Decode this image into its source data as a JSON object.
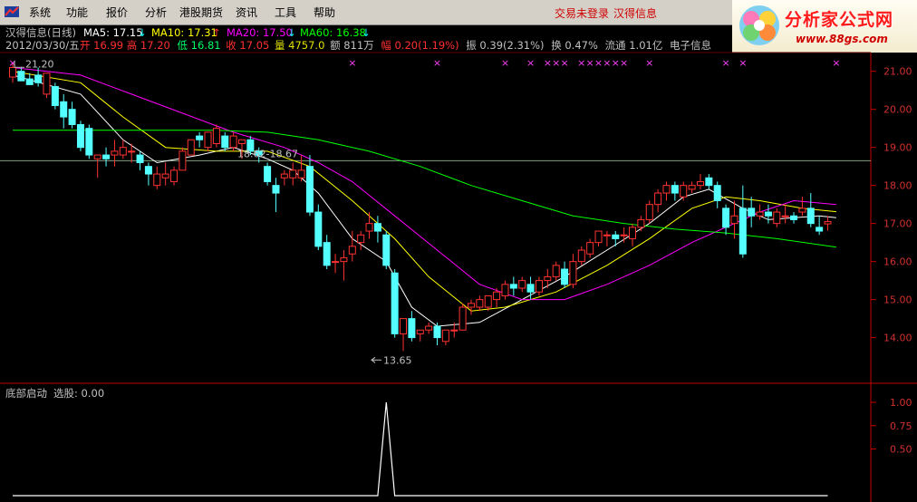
{
  "menubar": {
    "items": [
      "系统",
      "功能",
      "报价",
      "分析",
      "港股期货",
      "资讯",
      "工具",
      "帮助"
    ],
    "login_status": "交易未登录",
    "stock_link": "汉得信息"
  },
  "brand": {
    "title": "分析家公式网",
    "url": "www.88gs.com"
  },
  "header": {
    "title": "汉得信息(日线)",
    "ma": [
      {
        "label": "MA5: 17.15",
        "arrow": "↓",
        "color": "#ffffff"
      },
      {
        "label": "MA10: 17.31",
        "arrow": "↑",
        "color": "#ffff00"
      },
      {
        "label": "MA20: 17.50",
        "arrow": "↓",
        "color": "#ff00ff"
      },
      {
        "label": "MA60: 16.38",
        "arrow": "↓",
        "color": "#00ff00"
      }
    ],
    "info": {
      "date": "2012/03/30/五",
      "open_label": "开",
      "open": "16.99",
      "high_label": "高",
      "high": "17.20",
      "low_label": "低",
      "low": "16.81",
      "close_label": "收",
      "close": "17.05",
      "volume_label": "量",
      "volume": "4757.0",
      "amount_label": "额",
      "amount": "811万",
      "change_label": "幅",
      "change": "0.20(1.19%)",
      "amp_label": "振",
      "amp": "0.39(2.31%)",
      "turnover_label": "换",
      "turnover": "0.47%",
      "float_label": "流通",
      "float": "1.01亿",
      "sector": "电子信息"
    }
  },
  "price_panel": {
    "ymin": 13.3,
    "ymax": 21.35,
    "y_ticks": [
      21.0,
      20.0,
      19.0,
      18.0,
      17.0,
      16.0,
      15.0,
      14.0
    ],
    "marks": {
      "high": "21.20",
      "low": "13.65",
      "range": "18.62-18.67"
    },
    "hline_price": 18.65,
    "signal_marker": "×"
  },
  "indicator_panel": {
    "name": "底部启动",
    "label": "选股: 0.00",
    "y_ticks": [
      "1.00",
      "0.75",
      "0.50"
    ],
    "spike_value": 1.0
  },
  "chart_data": {
    "type": "candlestick",
    "title": "汉得信息(日线)",
    "candles": [
      [
        20.85,
        21.2,
        21.1,
        20.7
      ],
      [
        21.0,
        21.1,
        20.75,
        20.8
      ],
      [
        20.8,
        20.95,
        20.65,
        20.7
      ],
      [
        20.9,
        21.1,
        20.7,
        20.6
      ],
      [
        20.4,
        20.9,
        20.95,
        20.3
      ],
      [
        20.6,
        20.7,
        20.1,
        20.0
      ],
      [
        20.2,
        20.4,
        19.8,
        19.5
      ],
      [
        20.0,
        20.2,
        19.6,
        19.5
      ],
      [
        19.6,
        19.7,
        19.0,
        18.9
      ],
      [
        19.5,
        19.6,
        18.8,
        18.7
      ],
      [
        18.7,
        18.8,
        18.8,
        18.2
      ],
      [
        18.8,
        19.0,
        18.7,
        18.5
      ],
      [
        18.8,
        19.2,
        18.9,
        18.5
      ],
      [
        18.8,
        19.2,
        19.0,
        18.7
      ],
      [
        18.9,
        19.1,
        18.9,
        18.6
      ],
      [
        18.8,
        18.9,
        18.6,
        18.4
      ],
      [
        18.5,
        18.6,
        18.3,
        18.0
      ],
      [
        18.0,
        18.5,
        18.3,
        17.9
      ],
      [
        18.2,
        18.6,
        18.3,
        18.0
      ],
      [
        18.1,
        18.5,
        18.4,
        18.0
      ],
      [
        18.4,
        19.0,
        18.9,
        18.4
      ],
      [
        18.8,
        19.2,
        19.2,
        18.8
      ],
      [
        19.3,
        19.4,
        19.2,
        19.0
      ],
      [
        19.0,
        19.1,
        19.4,
        18.9
      ],
      [
        19.1,
        19.6,
        19.5,
        19.0
      ],
      [
        19.3,
        19.4,
        19.0,
        18.9
      ],
      [
        19.0,
        19.4,
        19.3,
        18.9
      ],
      [
        19.1,
        19.2,
        19.2,
        18.7
      ],
      [
        19.2,
        19.3,
        18.9,
        18.8
      ],
      [
        18.9,
        19.0,
        18.8,
        18.6
      ],
      [
        18.5,
        18.6,
        18.1,
        18.0
      ],
      [
        18.0,
        18.2,
        17.8,
        17.3
      ],
      [
        18.2,
        18.4,
        18.3,
        18.0
      ],
      [
        18.2,
        18.6,
        18.4,
        18.0
      ],
      [
        18.2,
        18.8,
        18.4,
        18.1
      ],
      [
        18.5,
        18.8,
        17.3,
        17.2
      ],
      [
        17.3,
        17.5,
        16.4,
        16.3
      ],
      [
        16.5,
        16.7,
        15.9,
        15.8
      ],
      [
        16.0,
        16.2,
        16.0,
        15.7
      ],
      [
        16.0,
        16.3,
        16.1,
        15.5
      ],
      [
        16.2,
        16.8,
        16.4,
        16.0
      ],
      [
        16.5,
        16.8,
        16.7,
        16.3
      ],
      [
        16.8,
        17.3,
        17.0,
        16.6
      ],
      [
        17.0,
        17.2,
        16.8,
        16.5
      ],
      [
        16.7,
        16.8,
        15.9,
        15.8
      ],
      [
        15.7,
        15.8,
        14.1,
        14.0
      ],
      [
        14.1,
        14.3,
        14.5,
        13.65
      ],
      [
        14.5,
        14.7,
        14.0,
        13.9
      ],
      [
        14.1,
        14.2,
        14.2,
        13.9
      ],
      [
        14.2,
        14.4,
        14.3,
        14.1
      ],
      [
        14.3,
        14.4,
        14.0,
        13.8
      ],
      [
        13.9,
        14.2,
        14.2,
        13.8
      ],
      [
        14.2,
        14.4,
        14.2,
        14.0
      ],
      [
        14.2,
        14.9,
        14.8,
        14.2
      ],
      [
        14.8,
        15.0,
        14.9,
        14.6
      ],
      [
        14.8,
        15.1,
        15.0,
        14.7
      ],
      [
        14.8,
        15.1,
        15.1,
        14.7
      ],
      [
        15.0,
        15.3,
        15.2,
        14.8
      ],
      [
        15.1,
        15.5,
        15.4,
        15.0
      ],
      [
        15.4,
        15.6,
        15.3,
        15.1
      ],
      [
        15.3,
        15.6,
        15.5,
        15.2
      ],
      [
        15.4,
        15.6,
        15.2,
        15.0
      ],
      [
        15.2,
        15.6,
        15.5,
        15.1
      ],
      [
        15.5,
        15.8,
        15.6,
        15.3
      ],
      [
        15.6,
        16.0,
        15.9,
        15.5
      ],
      [
        15.8,
        16.0,
        15.4,
        15.3
      ],
      [
        15.4,
        16.2,
        16.0,
        15.3
      ],
      [
        16.0,
        16.4,
        16.3,
        15.9
      ],
      [
        16.2,
        16.6,
        16.5,
        16.1
      ],
      [
        16.5,
        16.8,
        16.8,
        16.4
      ],
      [
        16.7,
        16.8,
        16.7,
        16.4
      ],
      [
        16.7,
        16.8,
        16.6,
        16.4
      ],
      [
        16.7,
        16.9,
        16.7,
        16.5
      ],
      [
        16.6,
        17.0,
        16.9,
        16.4
      ],
      [
        16.9,
        17.2,
        17.1,
        16.8
      ],
      [
        17.1,
        17.6,
        17.5,
        17.0
      ],
      [
        17.5,
        17.9,
        17.8,
        17.3
      ],
      [
        17.8,
        18.1,
        18.0,
        17.6
      ],
      [
        18.0,
        18.1,
        17.8,
        17.6
      ],
      [
        17.7,
        18.1,
        18.0,
        17.6
      ],
      [
        17.9,
        18.1,
        18.0,
        17.8
      ],
      [
        18.0,
        18.3,
        18.1,
        17.9
      ],
      [
        18.2,
        18.3,
        18.0,
        17.9
      ],
      [
        18.0,
        18.1,
        17.6,
        17.4
      ],
      [
        17.4,
        17.5,
        16.9,
        16.7
      ],
      [
        17.0,
        17.6,
        17.2,
        16.6
      ],
      [
        17.4,
        18.0,
        16.2,
        16.1
      ],
      [
        17.4,
        17.7,
        17.2,
        16.9
      ],
      [
        17.2,
        17.5,
        17.3,
        17.1
      ],
      [
        17.3,
        17.5,
        17.2,
        17.0
      ],
      [
        17.0,
        17.4,
        17.3,
        16.9
      ],
      [
        17.2,
        17.5,
        17.2,
        17.0
      ],
      [
        17.2,
        17.3,
        17.1,
        17.0
      ],
      [
        17.3,
        17.7,
        17.4,
        17.2
      ],
      [
        17.4,
        17.8,
        17.0,
        16.9
      ],
      [
        16.9,
        17.2,
        16.8,
        16.7
      ],
      [
        16.99,
        17.2,
        17.05,
        16.81
      ]
    ],
    "ma_series": [
      {
        "name": "MA5",
        "color": "#ffffff",
        "points": [
          [
            0,
            20.9
          ],
          [
            8,
            20.4
          ],
          [
            13,
            19.2
          ],
          [
            17,
            18.6
          ],
          [
            22,
            18.8
          ],
          [
            26,
            19.0
          ],
          [
            30,
            18.7
          ],
          [
            33,
            18.4
          ],
          [
            36,
            17.8
          ],
          [
            40,
            16.6
          ],
          [
            44,
            16.0
          ],
          [
            47,
            14.8
          ],
          [
            50,
            14.3
          ],
          [
            55,
            14.4
          ],
          [
            60,
            15.0
          ],
          [
            65,
            15.6
          ],
          [
            70,
            16.3
          ],
          [
            75,
            17.0
          ],
          [
            79,
            17.7
          ],
          [
            82,
            17.9
          ],
          [
            86,
            17.4
          ],
          [
            89,
            17.1
          ],
          [
            95,
            17.2
          ],
          [
            97,
            17.15
          ]
        ]
      },
      {
        "name": "MA10",
        "color": "#ffff00",
        "points": [
          [
            0,
            21.0
          ],
          [
            8,
            20.7
          ],
          [
            13,
            19.8
          ],
          [
            18,
            19.0
          ],
          [
            24,
            18.9
          ],
          [
            30,
            18.9
          ],
          [
            35,
            18.5
          ],
          [
            40,
            17.6
          ],
          [
            45,
            16.6
          ],
          [
            49,
            15.6
          ],
          [
            54,
            14.7
          ],
          [
            58,
            14.8
          ],
          [
            64,
            15.2
          ],
          [
            70,
            15.9
          ],
          [
            75,
            16.6
          ],
          [
            80,
            17.4
          ],
          [
            84,
            17.7
          ],
          [
            88,
            17.6
          ],
          [
            93,
            17.4
          ],
          [
            97,
            17.31
          ]
        ]
      },
      {
        "name": "MA20",
        "color": "#ff00ff",
        "points": [
          [
            0,
            21.1
          ],
          [
            8,
            20.9
          ],
          [
            14,
            20.4
          ],
          [
            20,
            19.9
          ],
          [
            26,
            19.4
          ],
          [
            32,
            19.0
          ],
          [
            36,
            18.6
          ],
          [
            40,
            18.1
          ],
          [
            45,
            17.2
          ],
          [
            50,
            16.3
          ],
          [
            55,
            15.4
          ],
          [
            60,
            15.0
          ],
          [
            65,
            15.0
          ],
          [
            70,
            15.4
          ],
          [
            75,
            15.9
          ],
          [
            80,
            16.5
          ],
          [
            84,
            16.9
          ],
          [
            88,
            17.3
          ],
          [
            92,
            17.6
          ],
          [
            97,
            17.5
          ]
        ]
      },
      {
        "name": "MA60",
        "color": "#00ff00",
        "points": [
          [
            0,
            19.45
          ],
          [
            12,
            19.45
          ],
          [
            24,
            19.45
          ],
          [
            30,
            19.4
          ],
          [
            36,
            19.2
          ],
          [
            42,
            18.9
          ],
          [
            48,
            18.5
          ],
          [
            54,
            18.0
          ],
          [
            60,
            17.6
          ],
          [
            66,
            17.2
          ],
          [
            72,
            17.0
          ],
          [
            78,
            16.85
          ],
          [
            84,
            16.75
          ],
          [
            90,
            16.6
          ],
          [
            97,
            16.38
          ]
        ]
      }
    ],
    "signal_indices": [
      0,
      40,
      50,
      58,
      61,
      63,
      64,
      65,
      67,
      68,
      69,
      70,
      71,
      72,
      75,
      84,
      86,
      97
    ],
    "indicator_spike_index": 44
  }
}
